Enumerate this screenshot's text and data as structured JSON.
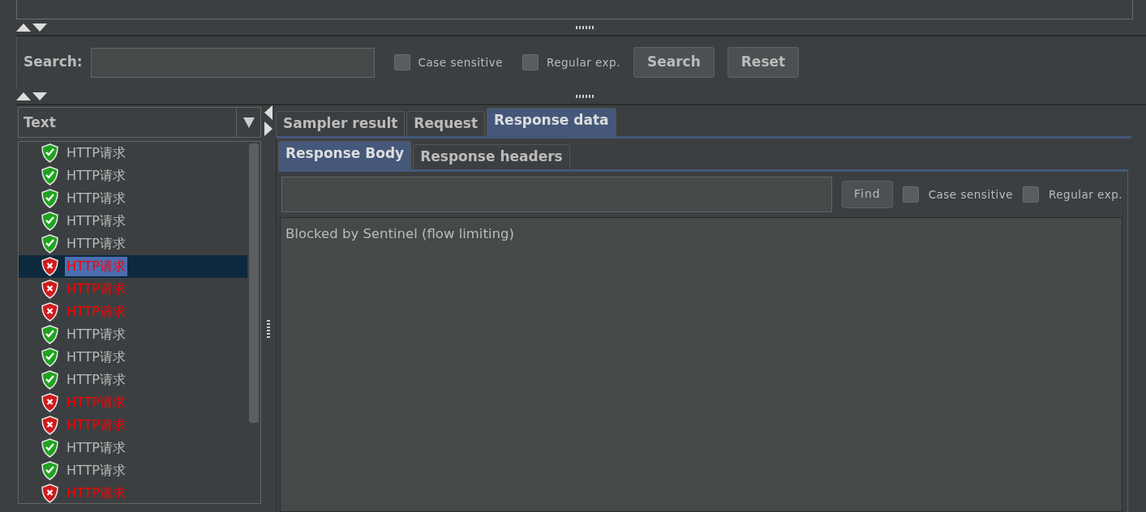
{
  "search": {
    "label": "Search:",
    "options": [
      {
        "label": "Case sensitive",
        "checked": false
      },
      {
        "label": "Regular exp.",
        "checked": false
      }
    ],
    "buttons": [
      "Search",
      "Reset"
    ]
  },
  "renderer": {
    "value": "Text"
  },
  "results": [
    {
      "label": "HTTP请求",
      "kind": "success",
      "selected": false
    },
    {
      "label": "HTTP请求",
      "kind": "success",
      "selected": false
    },
    {
      "label": "HTTP请求",
      "kind": "success",
      "selected": false
    },
    {
      "label": "HTTP请求",
      "kind": "success",
      "selected": false
    },
    {
      "label": "HTTP请求",
      "kind": "success",
      "selected": false
    },
    {
      "label": "HTTP请求",
      "kind": "error",
      "selected": true
    },
    {
      "label": "HTTP请求",
      "kind": "error",
      "selected": false
    },
    {
      "label": "HTTP请求",
      "kind": "error",
      "selected": false
    },
    {
      "label": "HTTP请求",
      "kind": "success",
      "selected": false
    },
    {
      "label": "HTTP请求",
      "kind": "success",
      "selected": false
    },
    {
      "label": "HTTP请求",
      "kind": "success",
      "selected": false
    },
    {
      "label": "HTTP请求",
      "kind": "error",
      "selected": false
    },
    {
      "label": "HTTP请求",
      "kind": "error",
      "selected": false
    },
    {
      "label": "HTTP请求",
      "kind": "success",
      "selected": false
    },
    {
      "label": "HTTP请求",
      "kind": "success",
      "selected": false
    },
    {
      "label": "HTTP请求",
      "kind": "error",
      "selected": false
    }
  ],
  "tabs": [
    {
      "label": "Sampler result",
      "selected": false
    },
    {
      "label": "Request",
      "selected": false
    },
    {
      "label": "Response data",
      "selected": true
    }
  ],
  "subtabs": [
    {
      "label": "Response Body",
      "selected": true
    },
    {
      "label": "Response headers",
      "selected": false
    }
  ],
  "find": {
    "button": "Find",
    "options": [
      {
        "label": "Case sensitive",
        "checked": false
      },
      {
        "label": "Regular exp.",
        "checked": false
      }
    ]
  },
  "response_body": "Blocked by Sentinel (flow limiting)"
}
